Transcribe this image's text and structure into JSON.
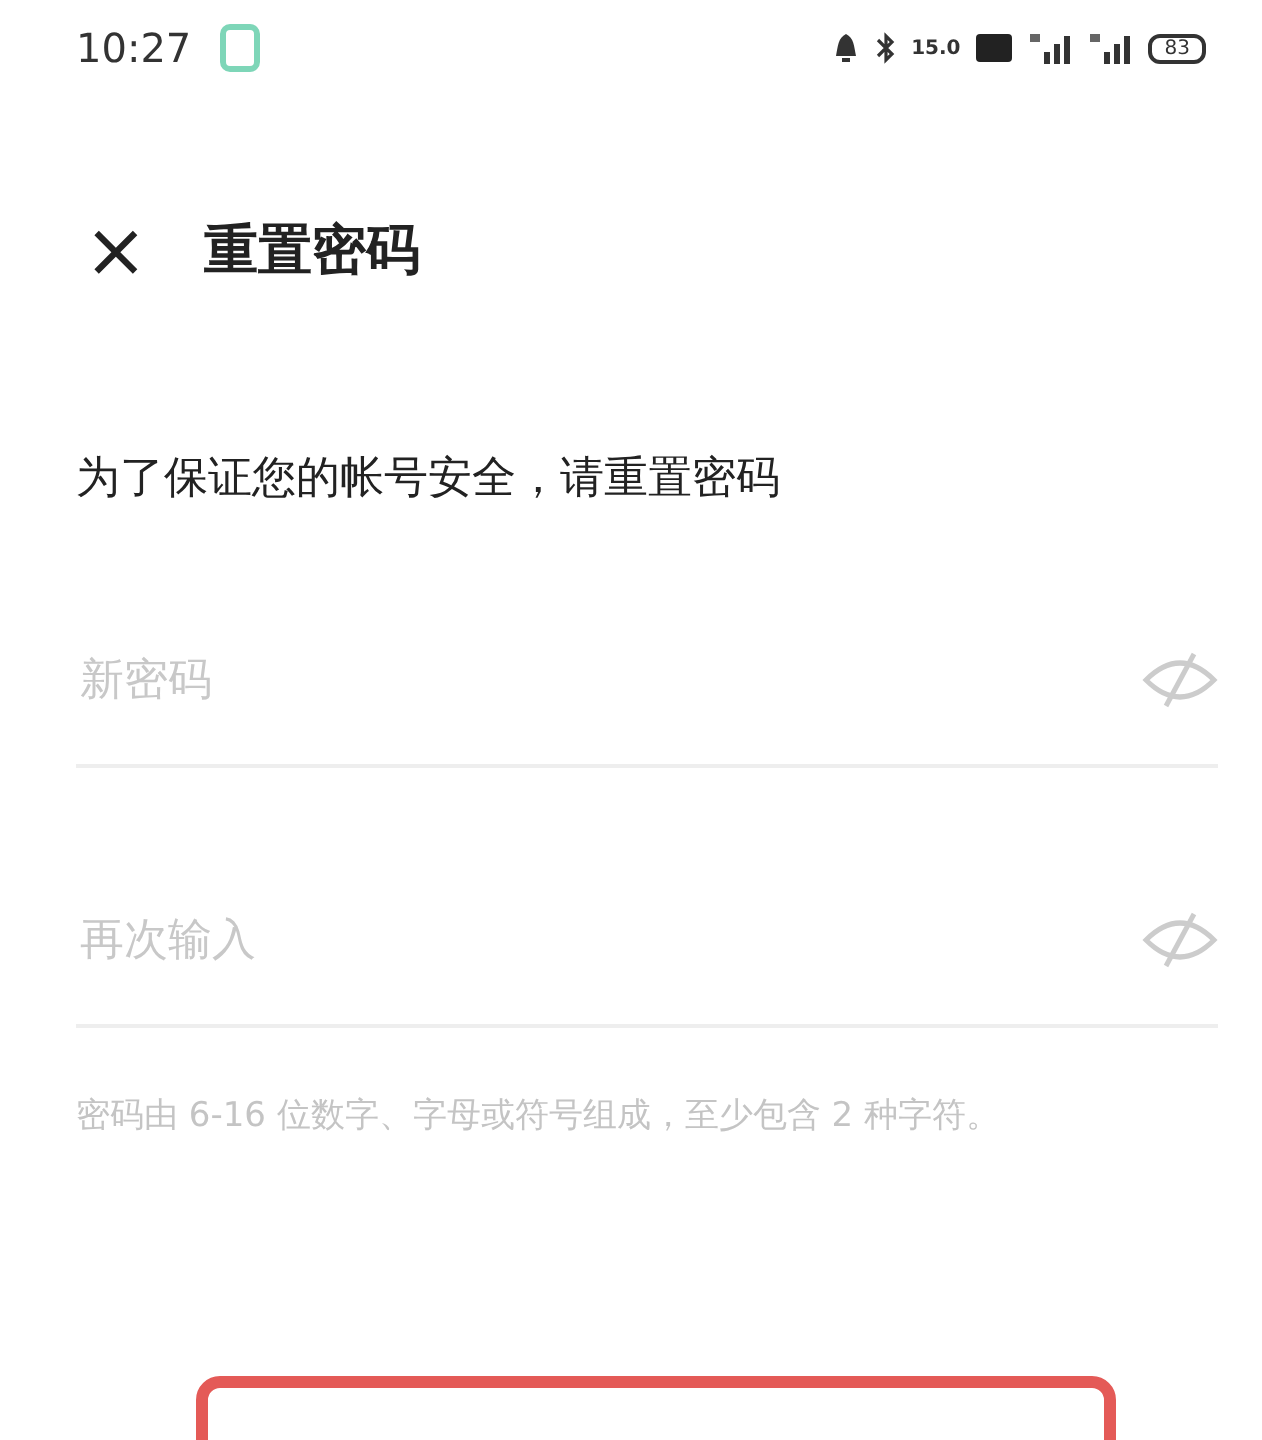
{
  "status_bar": {
    "time": "10:27",
    "net_speed": "15.0",
    "battery": "83"
  },
  "header": {
    "close": "×",
    "title": "重置密码"
  },
  "subtitle": "为了保证您的帐号安全，请重置密码",
  "fields": [
    {
      "placeholder": "新密码"
    },
    {
      "placeholder": "再次输入"
    }
  ],
  "hint": "密码由 6-16 位数字、字母或符号组成，至少包含 2 种字符。"
}
